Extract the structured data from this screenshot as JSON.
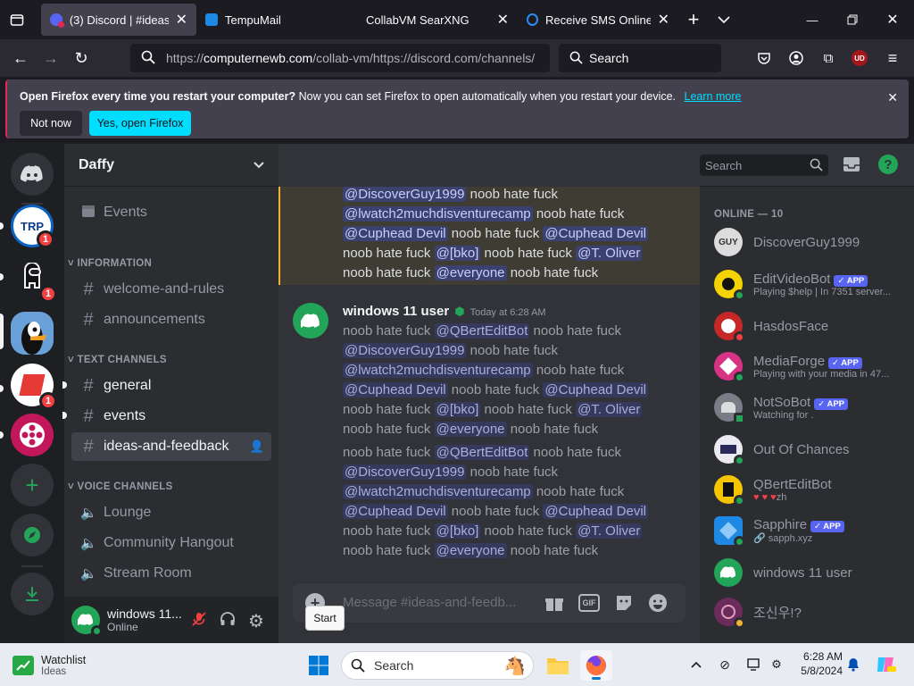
{
  "browser": {
    "tabs": [
      {
        "label": "(3) Discord | #ideas-and-",
        "active": true
      },
      {
        "label": "TempuMail",
        "active": false
      },
      {
        "label": "CollabVM SearXNG",
        "active": false
      },
      {
        "label": "Receive SMS Online - S",
        "active": false
      }
    ],
    "url_prefix": "https://",
    "url_domain": "computernewb.com",
    "url_rest": "/collab-vm/https://discord.com/channels/",
    "search_placeholder": "Search",
    "profile_badge": "UD"
  },
  "infobar": {
    "bold": "Open Firefox every time you restart your computer?",
    "text": " Now you can set Firefox to open automatically when you restart your device.",
    "link": "Learn more",
    "not_now": "Not now",
    "yes": "Yes, open Firefox"
  },
  "discord": {
    "guilds": [
      {
        "name": "home",
        "badge": ""
      },
      {
        "name": "TRP",
        "badge": "1"
      },
      {
        "name": "among",
        "badge": "1"
      },
      {
        "name": "daffy",
        "badge": ""
      },
      {
        "name": "red",
        "badge": "1"
      },
      {
        "name": "film",
        "badge": ""
      }
    ],
    "server_name": "Daffy",
    "events_label": "Events",
    "categories": {
      "information": "INFORMATION",
      "text": "TEXT CHANNELS",
      "voice": "VOICE CHANNELS"
    },
    "info_channels": [
      "welcome-and-rules",
      "announcements"
    ],
    "text_channels": [
      "general",
      "events",
      "ideas-and-feedback"
    ],
    "voice_channels": [
      "Lounge",
      "Community Hangout",
      "Stream Room"
    ],
    "user": {
      "name": "windows 11...",
      "status": "Online"
    },
    "channel_title": "ideas-and-feedback",
    "header_search": "Search",
    "message_placeholder": "Message #ideas-and-feedb...",
    "gif_label": "GIF",
    "tooltip": "Start",
    "mentions": {
      "m1": "@QBertEditBot",
      "m2": "@DiscoverGuy1999",
      "m3": "@lwatch2muchdisventurecamp",
      "m4": "@Cuphead Devil",
      "m5": "@[bko]",
      "m6": "@T. Oliver",
      "m7": "@everyone"
    },
    "phrase": "noob hate fuck",
    "author": "windows 11 user",
    "timestamp": "Today at 6:28 AM",
    "online_header": "ONLINE — 10",
    "members": [
      {
        "name": "DiscoverGuy1999",
        "sub": "",
        "app": false
      },
      {
        "name": "EditVideoBot",
        "sub": "Playing $help | In 7351 server...",
        "app": true
      },
      {
        "name": "HasdosFace",
        "sub": "",
        "app": false
      },
      {
        "name": "MediaForge",
        "sub": "Playing with your media in 47...",
        "app": true
      },
      {
        "name": "NotSoBot",
        "sub": "Watching for .",
        "app": true
      },
      {
        "name": "Out Of Chances",
        "sub": "",
        "app": false
      },
      {
        "name": "QBertEditBot",
        "sub": "zh",
        "app": false
      },
      {
        "name": "Sapphire",
        "sub": "sapph.xyz",
        "app": true
      },
      {
        "name": "windows 11 user",
        "sub": "",
        "app": false
      },
      {
        "name": "조신우!?",
        "sub": "",
        "app": false
      }
    ],
    "app_label": "APP",
    "guy_text": "GUY",
    "trp_text": "TRP"
  },
  "taskbar": {
    "widget_title": "Watchlist",
    "widget_sub": "Ideas",
    "search": "Search",
    "time": "6:28 AM",
    "date": "5/8/2024"
  },
  "colors": {
    "discord_blurple": "#5865f2",
    "online": "#23a559",
    "firefox_cyan": "#00ddff"
  }
}
